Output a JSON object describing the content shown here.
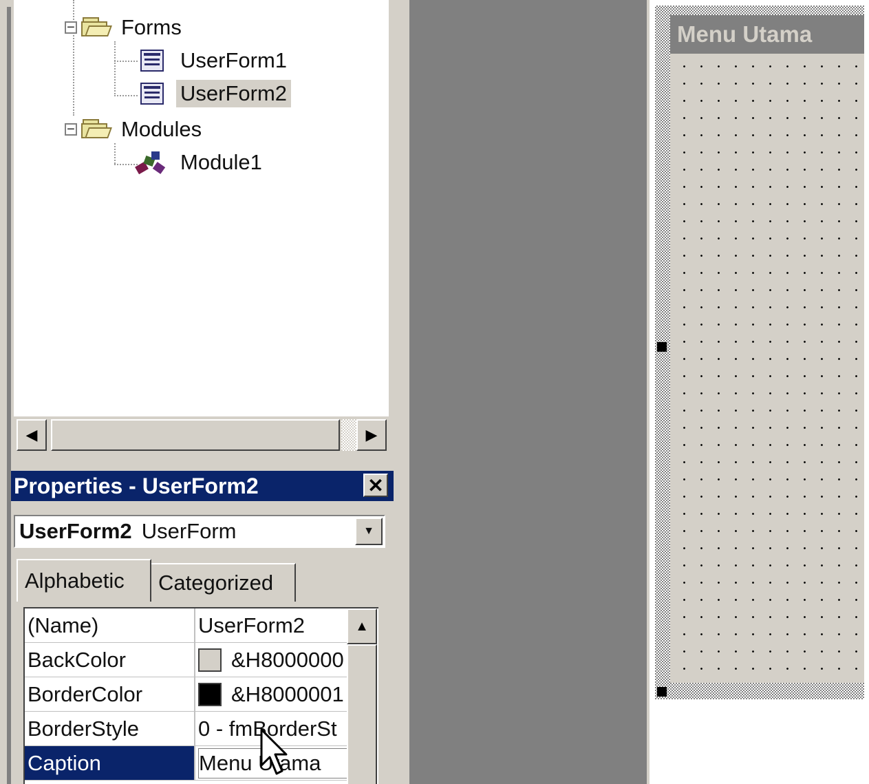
{
  "project_tree": {
    "items": [
      {
        "label": "Forms",
        "kind": "folder"
      },
      {
        "label": "UserForm1",
        "kind": "form"
      },
      {
        "label": "UserForm2",
        "kind": "form",
        "selected": true
      },
      {
        "label": "Modules",
        "kind": "folder"
      },
      {
        "label": "Module1",
        "kind": "module"
      }
    ]
  },
  "properties": {
    "title": "Properties - UserForm2",
    "object_name": "UserForm2",
    "object_type": "UserForm",
    "tabs": [
      "Alphabetic",
      "Categorized"
    ],
    "active_tab": "Alphabetic",
    "rows": [
      {
        "name": "(Name)",
        "value": "UserForm2"
      },
      {
        "name": "BackColor",
        "value": "&H8000000",
        "swatch": "#d4d0c8"
      },
      {
        "name": "BorderColor",
        "value": "&H8000001",
        "swatch": "#000000"
      },
      {
        "name": "BorderStyle",
        "value": "0 - fmBorderSt"
      },
      {
        "name": "Caption",
        "value": "Menu Utama",
        "selected": true
      }
    ]
  },
  "designer": {
    "form_caption": "Menu Utama"
  },
  "colors": {
    "title_bar": "#0a246a",
    "face": "#d4d0c8",
    "dark": "#808080"
  }
}
